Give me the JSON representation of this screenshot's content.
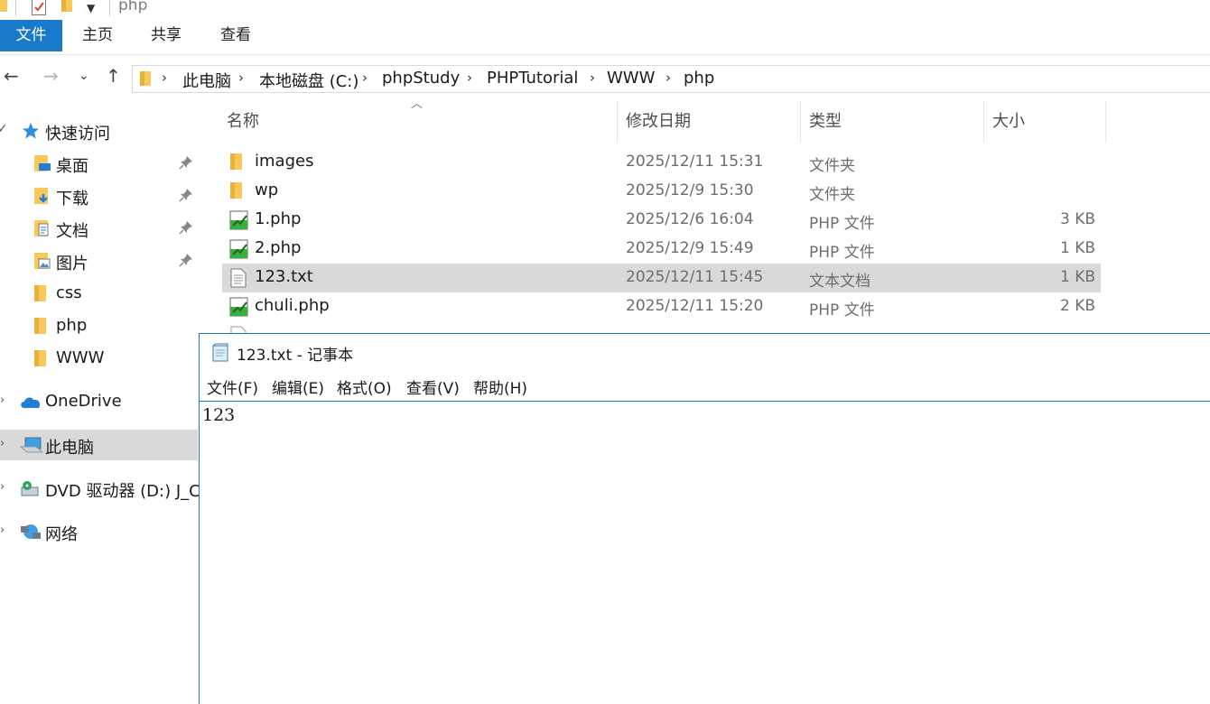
{
  "window": {
    "title": "php"
  },
  "ribbon": {
    "tabs": [
      "文件",
      "主页",
      "共享",
      "查看"
    ]
  },
  "address": {
    "breadcrumbs": [
      "此电脑",
      "本地磁盘 (C:)",
      "phpStudy",
      "PHPTutorial",
      "WWW",
      "php"
    ]
  },
  "nav": {
    "quick_access": "快速访问",
    "items": [
      {
        "label": "桌面",
        "pinned": true,
        "icon": "desktop-folder-icon"
      },
      {
        "label": "下载",
        "pinned": true,
        "icon": "downloads-folder-icon"
      },
      {
        "label": "文档",
        "pinned": true,
        "icon": "documents-folder-icon"
      },
      {
        "label": "图片",
        "pinned": true,
        "icon": "pictures-folder-icon"
      },
      {
        "label": "css",
        "pinned": false,
        "icon": "folder-icon"
      },
      {
        "label": "php",
        "pinned": false,
        "icon": "folder-icon"
      },
      {
        "label": "WWW",
        "pinned": false,
        "icon": "folder-icon"
      }
    ],
    "onedrive": "OneDrive",
    "this_pc": "此电脑",
    "dvd": "DVD 驱动器 (D:) J_CI",
    "network": "网络"
  },
  "files": {
    "columns": {
      "name": "名称",
      "date": "修改日期",
      "type": "类型",
      "size": "大小"
    },
    "rows": [
      {
        "name": "images",
        "date": "2025/12/11 15:31",
        "type": "文件夹",
        "size": "",
        "icon": "folder-icon"
      },
      {
        "name": "wp",
        "date": "2025/12/9 15:30",
        "type": "文件夹",
        "size": "",
        "icon": "folder-icon"
      },
      {
        "name": "1.php",
        "date": "2025/12/6 16:04",
        "type": "PHP 文件",
        "size": "3 KB",
        "icon": "php-file-icon"
      },
      {
        "name": "2.php",
        "date": "2025/12/9 15:49",
        "type": "PHP 文件",
        "size": "1 KB",
        "icon": "php-file-icon"
      },
      {
        "name": "123.txt",
        "date": "2025/12/11 15:45",
        "type": "文本文档",
        "size": "1 KB",
        "icon": "text-file-icon",
        "selected": true
      },
      {
        "name": "chuli.php",
        "date": "2025/12/11 15:20",
        "type": "PHP 文件",
        "size": "2 KB",
        "icon": "php-file-icon"
      }
    ]
  },
  "notepad": {
    "title": "123.txt - 记事本",
    "menu": [
      "文件(F)",
      "编辑(E)",
      "格式(O)",
      "查看(V)",
      "帮助(H)"
    ],
    "content": "123"
  },
  "colors": {
    "accent": "#1979ca",
    "selection": "#d9d9d9",
    "folder": "#f8c85a"
  }
}
